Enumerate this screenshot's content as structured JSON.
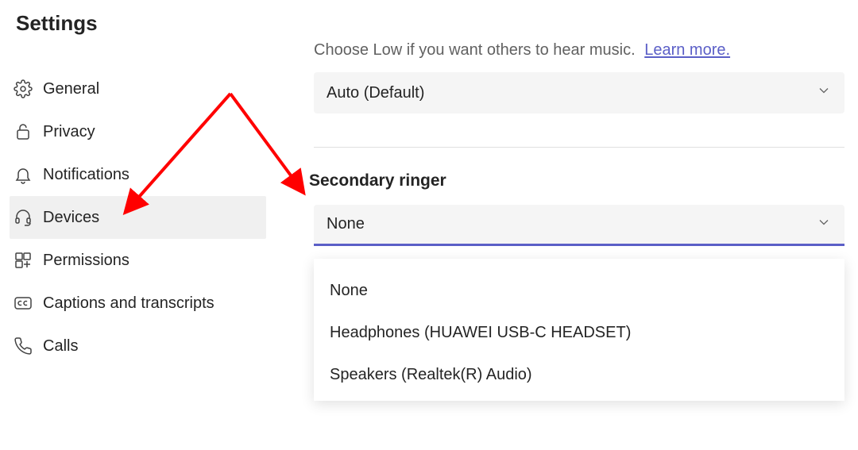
{
  "title": "Settings",
  "sidebar": {
    "items": [
      {
        "label": "General",
        "icon": "gear-icon"
      },
      {
        "label": "Privacy",
        "icon": "lock-icon"
      },
      {
        "label": "Notifications",
        "icon": "bell-icon"
      },
      {
        "label": "Devices",
        "icon": "headset-icon",
        "active": true
      },
      {
        "label": "Permissions",
        "icon": "grid-icon"
      },
      {
        "label": "Captions and transcripts",
        "icon": "cc-icon"
      },
      {
        "label": "Calls",
        "icon": "phone-icon"
      }
    ]
  },
  "main": {
    "helper_text": "Choose Low if you want others to hear music.",
    "learn_more": "Learn more.",
    "noise_suppression_value": "Auto (Default)",
    "secondary_ringer": {
      "label": "Secondary ringer",
      "value": "None",
      "options": [
        "None",
        "Headphones (HUAWEI USB-C HEADSET)",
        "Speakers (Realtek(R) Audio)"
      ]
    }
  },
  "annotation": {
    "arrow_color": "#ff0000"
  }
}
